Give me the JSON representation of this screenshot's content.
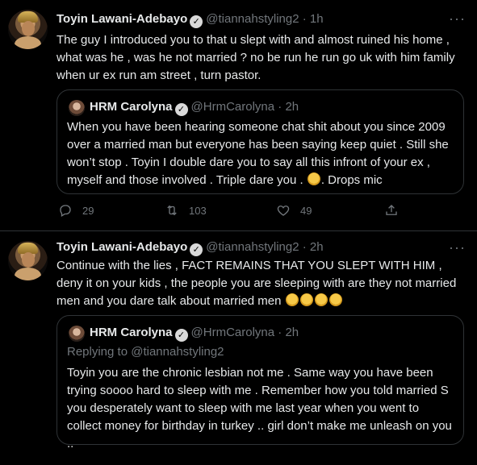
{
  "tweets": [
    {
      "author": "Toyin Lawani-Adebayo",
      "handle": "@tiannahstyling2",
      "time": "1h",
      "text": "The guy I introduced you to that u slept with and almost ruined his home , what was he , was he not married ? no be run he run go uk with him family when ur ex run am street , turn pastor.",
      "quote": {
        "author": "HRM Carolyna",
        "handle": "@HrmCarolyna",
        "time": "2h",
        "text_before_emoji": "When you have been hearing someone chat shit about you since 2009 over a married man but everyone has been saying keep quiet . Still she won’t stop . Toyin I double dare you to say all this infront of your ex  , myself and those involved . Triple dare you .",
        "text_after_emoji": ". Drops mic",
        "emoji": "face-blowing-kiss"
      },
      "stats": {
        "replies": "29",
        "retweets": "103",
        "likes": "49"
      }
    },
    {
      "author": "Toyin Lawani-Adebayo",
      "handle": "@tiannahstyling2",
      "time": "2h",
      "text": "Continue with the lies , FACT REMAINS THAT YOU SLEPT WITH HIM , deny it on your kids , the people you are sleeping with are they not married men and you dare talk about married men",
      "emoji_count": 4,
      "quote": {
        "author": "HRM Carolyna",
        "handle": "@HrmCarolyna",
        "time": "2h",
        "replying_to_label": "Replying to",
        "replying_to_handle": "@tiannahstyling2",
        "text": "Toyin you are the chronic lesbian not me . Same way you have been trying soooo hard to sleep with me . Remember how you told married S you desperately want to sleep with me last year when you went to collect money for birthday in turkey .. girl don’t make me unleash on you .."
      }
    }
  ],
  "icons": {
    "verified": "verified-badge-icon",
    "more": "more-options-icon",
    "reply": "reply-icon",
    "retweet": "retweet-icon",
    "like": "like-icon",
    "share": "share-icon"
  },
  "colors": {
    "background": "#000000",
    "text": "#e7e9ea",
    "secondary": "#71767b",
    "border": "#2f3336"
  }
}
